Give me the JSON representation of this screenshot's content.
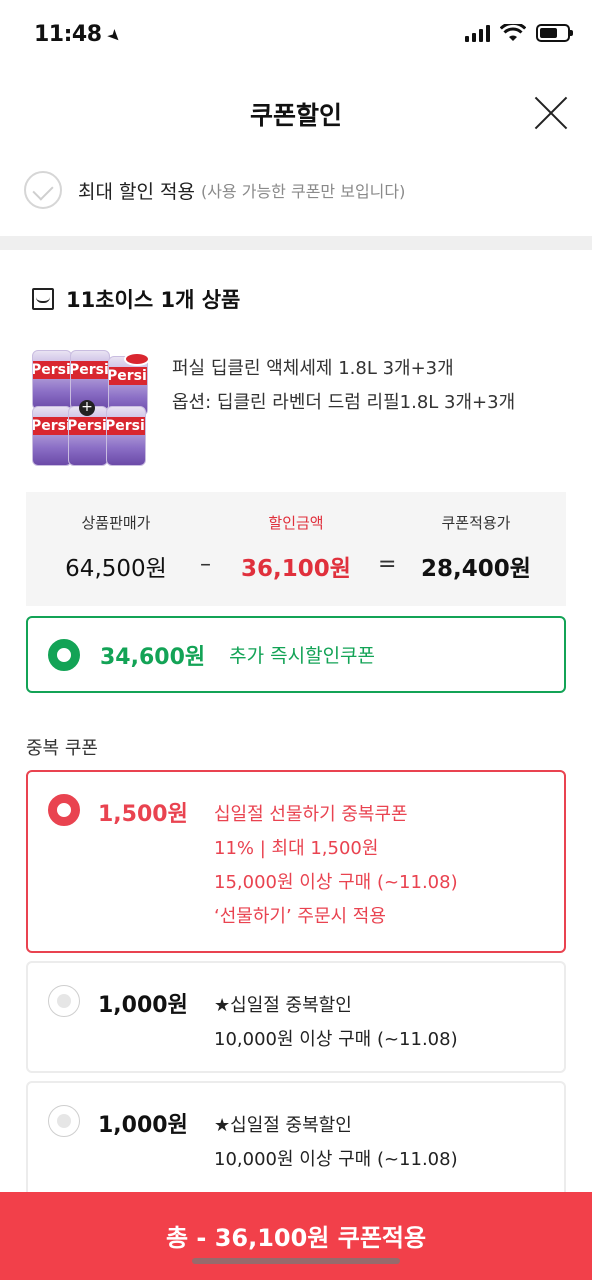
{
  "status_bar": {
    "time": "11:48"
  },
  "header": {
    "title": "쿠폰할인"
  },
  "max_discount": {
    "label": "최대 할인 적용",
    "note": "(사용 가능한 쿠폰만 보입니다)"
  },
  "store": {
    "label": "11초이스 1개 상품"
  },
  "product": {
    "name": "퍼실 딥클린 액체세제 1.8L 3개+3개",
    "option": "옵션: 딥클린 라벤더 드럼 리필1.8L 3개+3개",
    "image_brand_text": "Persil"
  },
  "price": {
    "sale_label": "상품판매가",
    "sale_value": "64,500원",
    "discount_label": "할인금액",
    "discount_value": "36,100원",
    "final_label": "쿠폰적용가",
    "final_value": "28,400원",
    "minus": "–",
    "equals": "="
  },
  "instant_coupon": {
    "amount": "34,600원",
    "label": "추가 즉시할인쿠폰",
    "color": "#13a356"
  },
  "duplicate_section": {
    "title": "중복 쿠폰"
  },
  "coupons": [
    {
      "amount": "1,500원",
      "selected": true,
      "lines": [
        "십일절 선물하기 중복쿠폰",
        "11% | 최대 1,500원",
        "15,000원 이상 구매 (~11.08)",
        "‘선물하기’ 주문시 적용"
      ]
    },
    {
      "amount": "1,000원",
      "selected": false,
      "lines": [
        "★십일절 중복할인",
        "10,000원 이상 구매 (~11.08)"
      ]
    },
    {
      "amount": "1,000원",
      "selected": false,
      "lines": [
        "★십일절 중복할인",
        "10,000원 이상 구매 (~11.08)"
      ]
    }
  ],
  "bottom_button": {
    "label": "총 - 36,100원 쿠폰적용",
    "color": "#f2404a"
  },
  "accent_red": "#e94350"
}
